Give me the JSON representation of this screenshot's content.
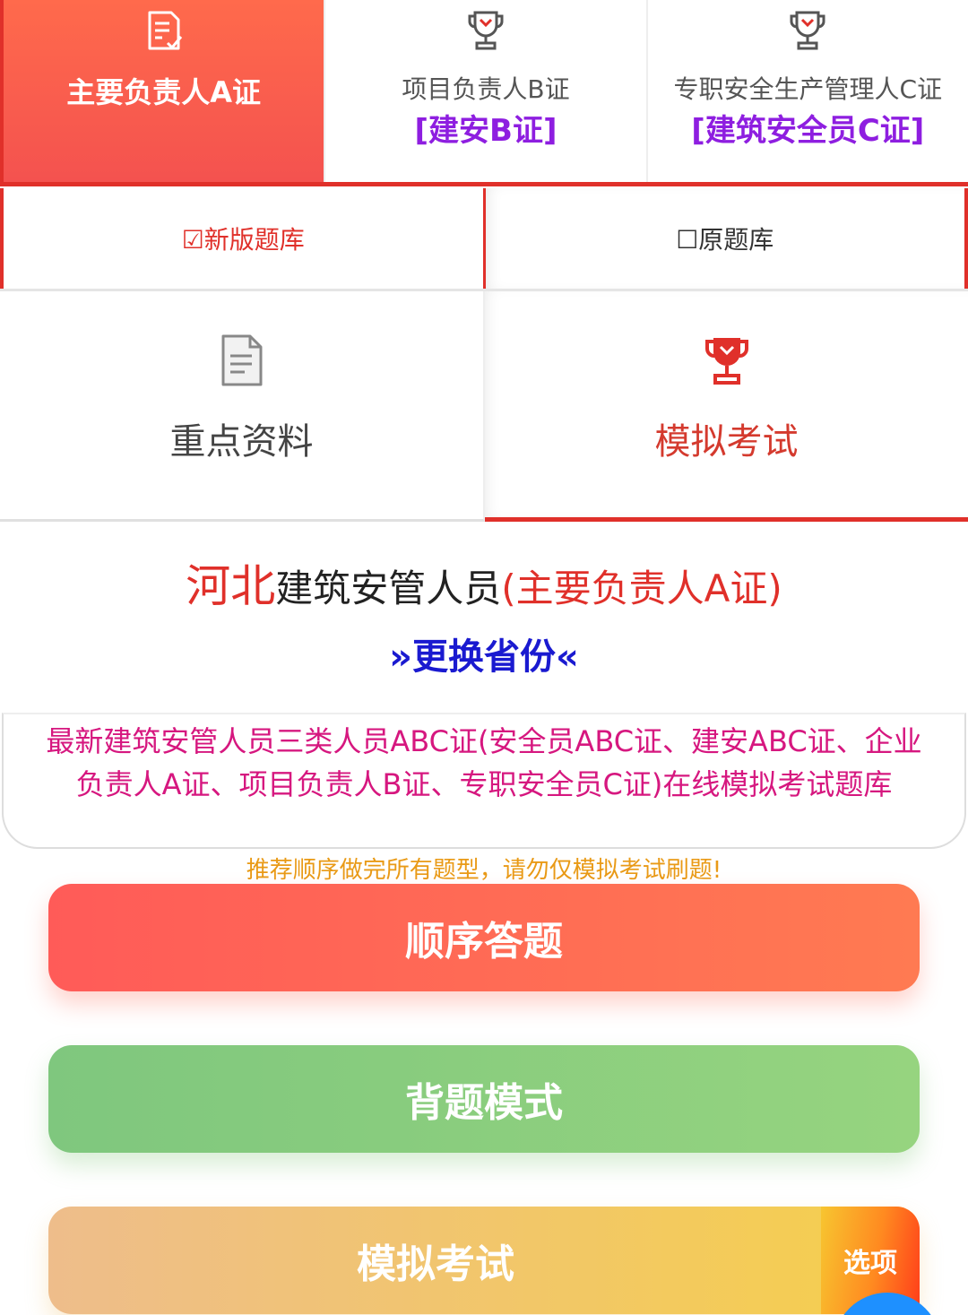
{
  "cert_tabs": [
    {
      "title": "主要负责人A证",
      "active": true,
      "icon": "document-edit-icon"
    },
    {
      "title": "项目负责人B证",
      "sub": "[建安B证]",
      "icon": "trophy-icon"
    },
    {
      "title": "专职安全生产管理人C证",
      "sub": "[建筑安全员C证]",
      "icon": "trophy-icon"
    }
  ],
  "bank_toggle": {
    "new_label": "☑新版题库",
    "old_label": "☐原题库"
  },
  "features": {
    "key_material": {
      "label": "重点资料",
      "icon": "document-icon"
    },
    "mock_exam": {
      "label": "模拟考试",
      "icon": "trophy-icon"
    }
  },
  "heading": {
    "province": "河北",
    "middle": "建筑安管人员",
    "cert": "(主要负责人A证)",
    "change_province": "»更换省份«"
  },
  "description": "最新建筑安管人员三类人员ABC证(安全员ABC证、建安ABC证、企业负责人A证、项目负责人B证、专职安全员C证)在线模拟考试题库",
  "tip": "推荐顺序做完所有题型，请勿仅模拟考试刷题!",
  "actions": {
    "sequential": "顺序答题",
    "recite": "背题模式",
    "mock_exam": "模拟考试",
    "options": "选项"
  },
  "colors": {
    "accent": "#e0302a",
    "purple": "#8e1ee0",
    "blue": "#1a1ad0",
    "magenta": "#d6177f",
    "orange": "#e99a16"
  }
}
